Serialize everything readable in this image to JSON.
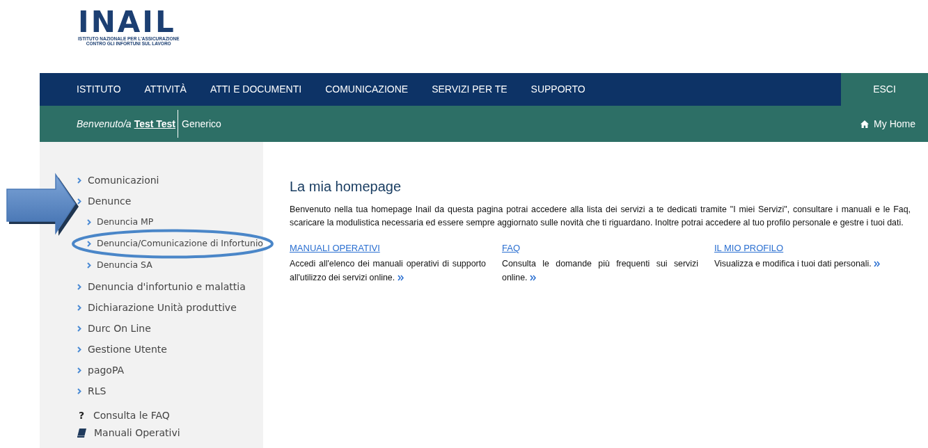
{
  "logo": {
    "wordmark": "INAIL",
    "subtitle_lines": [
      "ISTITUTO NAZIONALE PER L'ASSICURAZIONE",
      "CONTRO GLI INFORTUNI SUL LAVORO"
    ]
  },
  "main_nav": {
    "items": [
      "ISTITUTO",
      "ATTIVITÀ",
      "ATTI E DOCUMENTI",
      "COMUNICAZIONE",
      "SERVIZI PER TE",
      "SUPPORTO"
    ],
    "logout": "ESCI"
  },
  "user_bar": {
    "greeting": "Benvenuto/a",
    "user": "Test Test",
    "role": "Generico",
    "home_link": "My Home"
  },
  "sidebar": {
    "items": [
      {
        "label": "Comunicazioni"
      },
      {
        "label": "Denunce",
        "children": [
          {
            "label": "Denuncia MP"
          },
          {
            "label": "Denuncia/Comunicazione di Infortunio"
          },
          {
            "label": "Denuncia SA"
          }
        ]
      },
      {
        "label": "Denuncia d'infortunio e malattia"
      },
      {
        "label": "Dichiarazione Unità produttive"
      },
      {
        "label": "Durc On Line"
      },
      {
        "label": "Gestione Utente"
      },
      {
        "label": "pagoPA"
      },
      {
        "label": "RLS"
      }
    ],
    "links": [
      {
        "kind": "help",
        "icon": "?",
        "label": "Consulta le FAQ"
      },
      {
        "kind": "book",
        "label": "Manuali Operativi"
      }
    ]
  },
  "content": {
    "title": "La mia homepage",
    "intro": "Benvenuto nella tua homepage Inail da questa pagina potrai accedere alla lista dei servizi a te dedicati tramite \"I miei Servizi\", consultare i manuali e le Faq, scaricare la modulistica necessaria ed essere sempre aggiornato sulle novità che ti riguardano. Inoltre potrai accedere al tuo profilo personale e gestre i tuoi dati.",
    "sections": [
      {
        "title": "MANUALI OPERATIVI",
        "text": "Accedi all'elenco dei manuali operativi di supporto all'utilizzo dei servizi online."
      },
      {
        "title": "FAQ",
        "text": "Consulta le domande più frequenti sui servizi online."
      },
      {
        "title": "IL MIO PROFILO",
        "text": "Visualizza e modifica i tuoi dati personali."
      }
    ]
  },
  "annotations": {
    "arrow": true,
    "ellipse": true
  }
}
